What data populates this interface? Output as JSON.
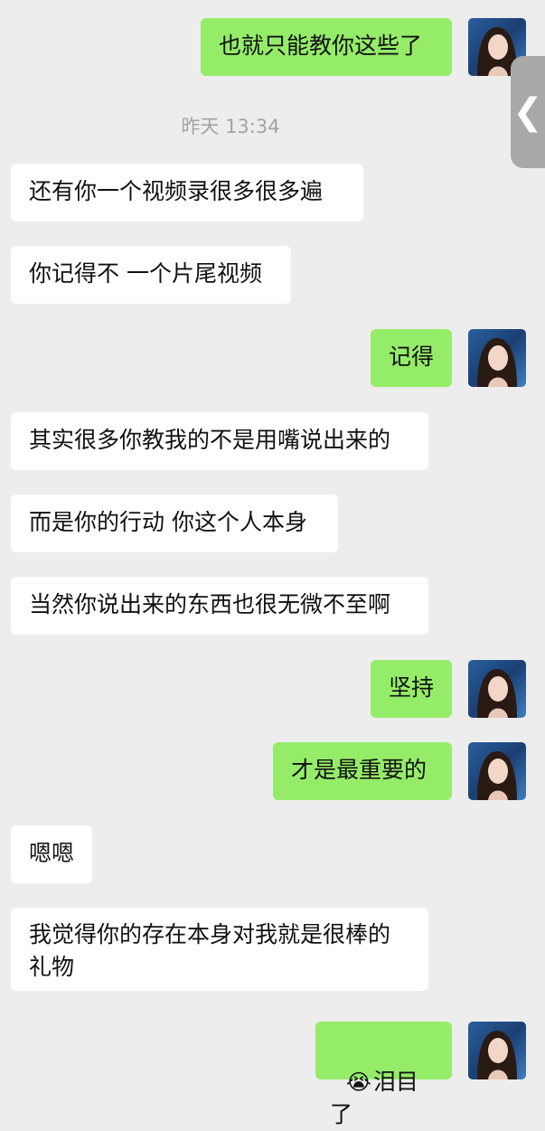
{
  "chat": {
    "timestamp": "昨天 13:34",
    "messages": [
      {
        "side": "sent",
        "text": "也就只能教你这些了"
      },
      {
        "side": "recv",
        "text": "还有你一个视频录很多很多遍"
      },
      {
        "side": "recv",
        "text": "你记得不 一个片尾视频"
      },
      {
        "side": "sent",
        "text": "记得"
      },
      {
        "side": "recv",
        "text": "其实很多你教我的不是用嘴说出来的"
      },
      {
        "side": "recv",
        "text": "而是你的行动 你这个人本身"
      },
      {
        "side": "recv",
        "text": "当然你说出来的东西也很无微不至啊"
      },
      {
        "side": "sent",
        "text": "坚持"
      },
      {
        "side": "sent",
        "text": "才是最重要的"
      },
      {
        "side": "recv",
        "text": "嗯嗯"
      },
      {
        "side": "recv",
        "text": "我觉得你的存在本身对我就是很棒的\n礼物"
      },
      {
        "side": "sent",
        "emoji": "😭",
        "text": "泪目了"
      }
    ]
  },
  "side_handle": {
    "icon": "chevron-left-icon",
    "glyph": "❮"
  },
  "colors": {
    "sent_bubble": "#95ec69",
    "recv_bubble": "#ffffff",
    "background": "#ededed"
  }
}
